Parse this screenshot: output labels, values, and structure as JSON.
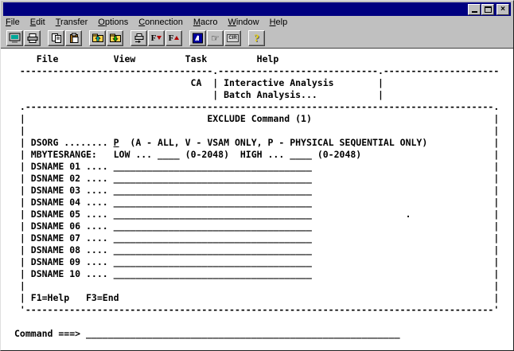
{
  "window": {
    "title": ""
  },
  "colors": {
    "titlebar": "#000080",
    "chrome": "#c0c0c0",
    "screen_bg": "#ffffff",
    "screen_fg": "#000000"
  },
  "menu_bar": {
    "items": [
      {
        "accel": "F",
        "rest": "ile"
      },
      {
        "accel": "E",
        "rest": "dit"
      },
      {
        "accel": "T",
        "rest": "ransfer"
      },
      {
        "accel": "O",
        "rest": "ptions"
      },
      {
        "accel": "C",
        "rest": "onnection"
      },
      {
        "accel": "M",
        "rest": "acro"
      },
      {
        "accel": "W",
        "rest": "indow"
      },
      {
        "accel": "H",
        "rest": "elp"
      }
    ]
  },
  "toolbar": {
    "f_label": "F",
    "cir_label": "CIR",
    "help_label": "?",
    "hand_glyph": "☞"
  },
  "terminal": {
    "host_menu": {
      "file": "    File",
      "view": "          View",
      "task": "         Task",
      "help": "         Help"
    },
    "menu_separator": " -----------------------------------.-----------------------------.---------------------",
    "task_dropdown": {
      "row1_prefix": "                                CA  | ",
      "interactive_analysis": "Interactive Analysis",
      "row1_suffix": "        |",
      "row2_prefix": "                                    | ",
      "batch_analysis": "Batch Analysis...",
      "row2_suffix": "           |"
    },
    "dialog": {
      "top_border": " .-------------------------------------------------------------------------------------.",
      "title_prefix": " |                                 ",
      "title": "EXCLUDE Command (1)",
      "title_suffix": "                                 |",
      "blank_row": " |                                                                                     |",
      "dsorg": {
        "prefix": " | DSORG ........ ",
        "value": "P",
        "suffix": "  (A - ALL, V - VSAM ONLY, P - PHYSICAL SEQUENTIAL ONLY)            |"
      },
      "mbytes": {
        "label": " | MBYTESRANGE:   LOW ... ",
        "low_field": "____",
        "mid": " (0-2048)  HIGH ... ",
        "high_field": "____",
        "suffix": " (0-2048)                        |"
      },
      "dsnames": [
        {
          "label": " | DSNAME 01 .... ",
          "field": "____________________________________",
          "suffix": "                                 |"
        },
        {
          "label": " | DSNAME 02 .... ",
          "field": "____________________________________",
          "suffix": "                                 |"
        },
        {
          "label": " | DSNAME 03 .... ",
          "field": "____________________________________",
          "suffix": "                                 |"
        },
        {
          "label": " | DSNAME 04 .... ",
          "field": "____________________________________",
          "suffix": "                                 |"
        },
        {
          "label": " | DSNAME 05 .... ",
          "field": "____________________________________",
          "suffix": "                 .               |"
        },
        {
          "label": " | DSNAME 06 .... ",
          "field": "____________________________________",
          "suffix": "                                 |"
        },
        {
          "label": " | DSNAME 07 .... ",
          "field": "____________________________________",
          "suffix": "                                 |"
        },
        {
          "label": " | DSNAME 08 .... ",
          "field": "____________________________________",
          "suffix": "                                 |"
        },
        {
          "label": " | DSNAME 09 .... ",
          "field": "____________________________________",
          "suffix": "                                 |"
        },
        {
          "label": " | DSNAME 10 .... ",
          "field": "____________________________________",
          "suffix": "                                 |"
        }
      ],
      "fkeys_row": " | F1=Help   F3=End                                                                    |",
      "bottom_border": " '-------------------------------------------------------------------------------------'"
    },
    "command": {
      "label": "Command ===> ",
      "field": "_________________________________________________________"
    }
  }
}
